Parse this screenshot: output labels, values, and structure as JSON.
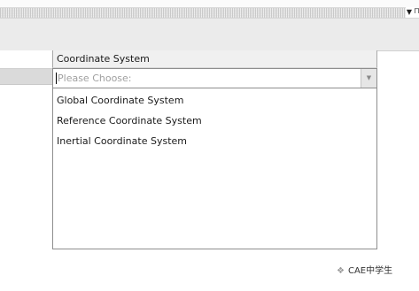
{
  "panel": {
    "menu_icon": "▼",
    "pin_icon": "⊓"
  },
  "field": {
    "header_label": "Coordinate System",
    "placeholder": "Please Choose:",
    "options": [
      "Global Coordinate System",
      "Reference Coordinate System",
      "Inertial Coordinate System"
    ]
  },
  "icons": {
    "dropdown_arrow": "▼",
    "watermark_logo": "wechat-icon"
  },
  "watermark": {
    "text": "CAE中学生"
  }
}
